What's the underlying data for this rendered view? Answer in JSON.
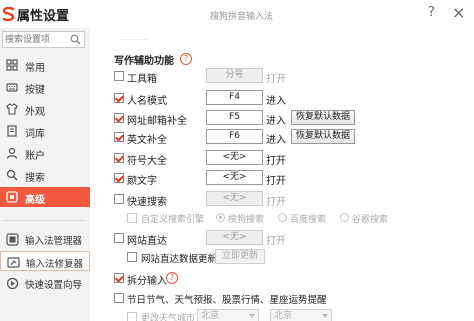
{
  "window": {
    "app_title": "属性设置",
    "subtitle": "搜狗拼音输入法",
    "help": "?",
    "close": "×"
  },
  "sidebar": {
    "search_placeholder": "搜索设置项",
    "items": [
      {
        "label": "常用",
        "icon": "grid-icon"
      },
      {
        "label": "按键",
        "icon": "keyboard-icon"
      },
      {
        "label": "外观",
        "icon": "shirt-icon"
      },
      {
        "label": "词库",
        "icon": "book-icon"
      },
      {
        "label": "账户",
        "icon": "user-icon"
      },
      {
        "label": "搜索",
        "icon": "magnifier-icon"
      },
      {
        "label": "高级",
        "icon": "advanced-icon"
      }
    ],
    "tools": [
      {
        "label": "输入法管理器",
        "icon": "manager-icon"
      },
      {
        "label": "输入法修复器",
        "icon": "repair-icon"
      },
      {
        "label": "快速设置向导",
        "icon": "wizard-icon"
      }
    ]
  },
  "main": {
    "section_title": "写作辅助功能",
    "rows": {
      "toolbox": {
        "label": "工具箱",
        "key": "分号",
        "action": "打开"
      },
      "name_mode": {
        "label": "人名模式",
        "key": "F4",
        "action": "进入"
      },
      "url_email": {
        "label": "网址邮箱补全",
        "key": "F5",
        "action": "进入",
        "button": "恢复默认数据"
      },
      "english": {
        "label": "英文补全",
        "key": "F6",
        "action": "进入",
        "button": "恢复默认数据"
      },
      "symbols": {
        "label": "符号大全",
        "key": "<无>",
        "action": "打开"
      },
      "emoticons": {
        "label": "颜文字",
        "key": "<无>",
        "action": "打开"
      },
      "quick_search": {
        "label": "快速搜索",
        "key": "<无>",
        "action": "打开"
      },
      "custom_engine": {
        "label": "自定义搜索引擎",
        "options": [
          "搜狗搜索",
          "百度搜索",
          "谷歌搜索"
        ]
      },
      "site_direct": {
        "label": "网站直达",
        "key": "<无>",
        "action": "打开"
      },
      "site_update": {
        "label": "网站直达数据更新",
        "button": "立即更新"
      },
      "split_input": {
        "label": "拆分输入"
      },
      "reminders": {
        "label": "节日节气、天气预报、股票行情、星座运势提醒"
      },
      "weather_city": {
        "label": "更改天气城市",
        "province": "北京",
        "city": "北京"
      }
    }
  }
}
